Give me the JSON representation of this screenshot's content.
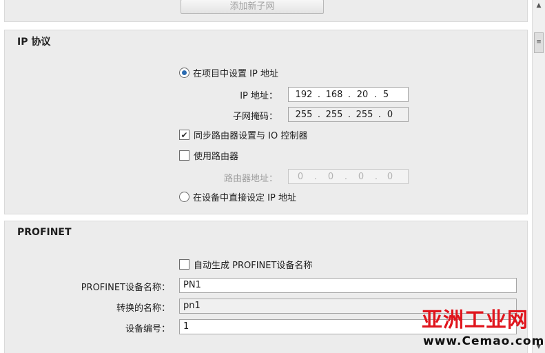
{
  "top_section": {
    "add_subnet_button": "添加新子网"
  },
  "ip_protocol": {
    "title": "IP 协议",
    "radio_set_in_project": {
      "label": "在项目中设置 IP 地址",
      "selected": true
    },
    "ip_address": {
      "label": "IP 地址：",
      "octets": [
        "192",
        "168",
        "20",
        "5"
      ]
    },
    "subnet_mask": {
      "label": "子网掩码：",
      "octets": [
        "255",
        "255",
        "255",
        "0"
      ]
    },
    "sync_router_checkbox": {
      "label": "同步路由器设置与 IO 控制器",
      "checked": true
    },
    "use_router_checkbox": {
      "label": "使用路由器",
      "checked": false
    },
    "router_address": {
      "label": "路由器地址：",
      "octets": [
        "0",
        "0",
        "0",
        "0"
      ]
    },
    "radio_set_on_device": {
      "label": "在设备中直接设定 IP 地址",
      "selected": false
    }
  },
  "profinet": {
    "title": "PROFINET",
    "auto_generate_checkbox": {
      "label": "自动生成 PROFINET设备名称",
      "checked": false
    },
    "device_name": {
      "label": "PROFINET设备名称：",
      "value": "PN1"
    },
    "converted_name": {
      "label": "转换的名称：",
      "value": "pn1"
    },
    "device_number": {
      "label": "设备编号：",
      "value": "1"
    }
  },
  "watermark": {
    "text_large": "亚洲工业网",
    "text_small": "www.Cemao.com"
  },
  "colors": {
    "panel_bg": "#ececec",
    "radio_dot": "#2a6ab0",
    "watermark_red": "#e0141c"
  }
}
